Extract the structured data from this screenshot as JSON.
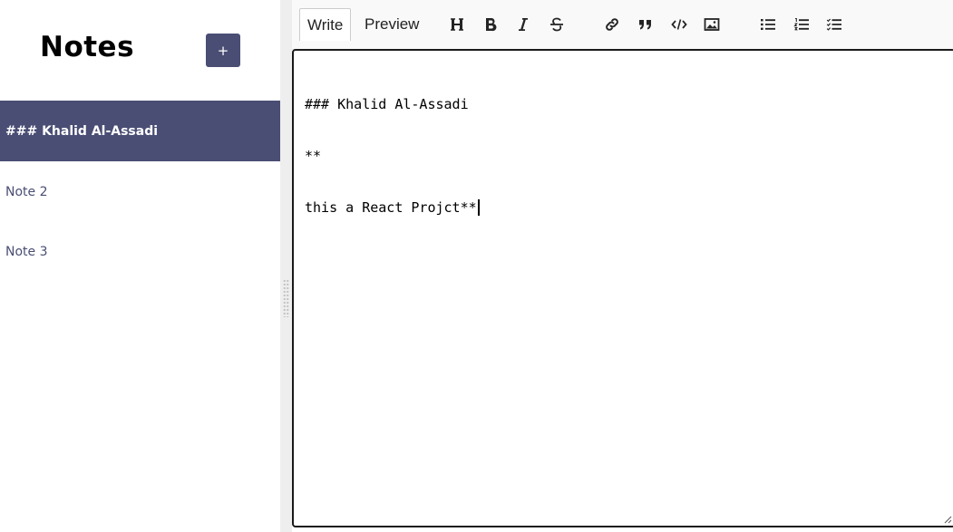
{
  "sidebar": {
    "title": "Notes",
    "add_button_label": "+",
    "notes": [
      {
        "label": "### Khalid Al-Assadi",
        "active": true
      },
      {
        "label": "Note 2",
        "active": false
      },
      {
        "label": "Note 3",
        "active": false
      }
    ]
  },
  "editor": {
    "tabs": [
      {
        "label": "Write",
        "active": true
      },
      {
        "label": "Preview",
        "active": false
      }
    ],
    "toolbar_icons": [
      "header-icon",
      "bold-icon",
      "italic-icon",
      "strikethrough-icon",
      "link-icon",
      "quote-icon",
      "code-icon",
      "image-icon",
      "unordered-list-icon",
      "ordered-list-icon",
      "checked-list-icon"
    ],
    "content_lines": [
      "### Khalid Al-Assadi",
      "**",
      "this a React Projct**"
    ]
  },
  "colors": {
    "accent": "#4a4e74",
    "gutter": "#eeeeee",
    "toolbar_bg": "#f9f9f9"
  }
}
